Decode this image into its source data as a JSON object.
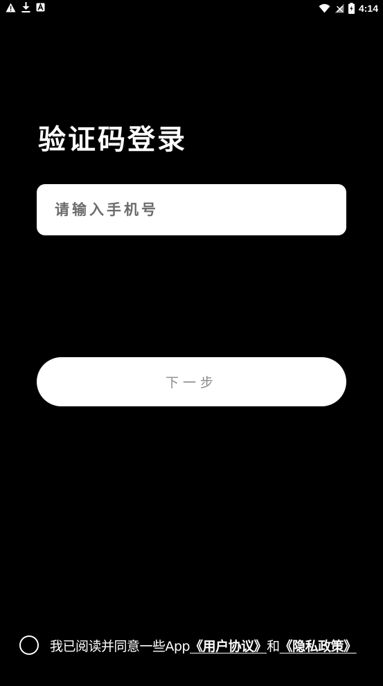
{
  "status_bar": {
    "time": "4:14",
    "left_icons": [
      "warning-icon",
      "download-icon",
      "app-notification-icon"
    ],
    "right_icons": [
      "wifi-icon",
      "signal-icon",
      "battery-icon"
    ]
  },
  "login": {
    "title": "验证码登录",
    "phone_placeholder": "请输入手机号",
    "phone_value": "",
    "next_label": "下一步"
  },
  "agreement": {
    "prefix": "我已阅读并同意一些App",
    "user_agreement": "《用户协议》",
    "conjunction": "和",
    "privacy_policy": "《隐私政策》",
    "checked": false
  },
  "colors": {
    "background": "#000000",
    "surface": "#ffffff",
    "placeholder": "#6b6b6b",
    "button_text": "#8a8a8a"
  }
}
